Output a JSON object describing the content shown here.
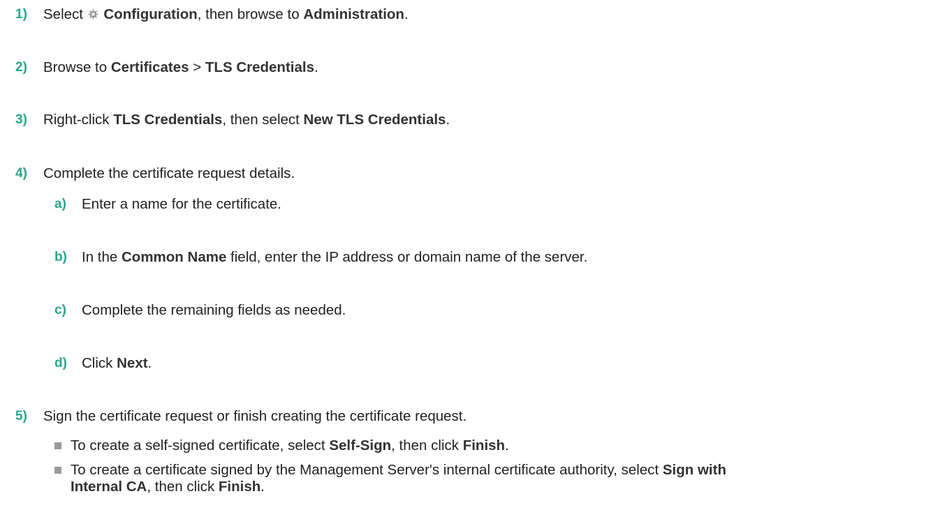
{
  "steps": [
    {
      "num": "1)",
      "t1": "Select ",
      "b1": "Configuration",
      "t2": ", then browse to ",
      "b2": "Administration",
      "t3": "."
    },
    {
      "num": "2)",
      "t1": "Browse to ",
      "b1": "Certificates",
      "t2": " > ",
      "b2": "TLS Credentials",
      "t3": "."
    },
    {
      "num": "3)",
      "t1": "Right-click ",
      "b1": "TLS Credentials",
      "t2": ", then select ",
      "b2": "New TLS Credentials",
      "t3": "."
    },
    {
      "num": "4)",
      "text": "Complete the certificate request details."
    },
    {
      "num": "5)",
      "text": "Sign the certificate request or finish creating the certificate request."
    }
  ],
  "substeps": [
    {
      "num": "a)",
      "text": "Enter a name for the certificate."
    },
    {
      "num": "b)",
      "t1": "In the ",
      "b1": "Common Name",
      "t2": " field, enter the IP address or domain name of the server."
    },
    {
      "num": "c)",
      "text": "Complete the remaining fields as needed."
    },
    {
      "num": "d)",
      "t1": "Click ",
      "b1": "Next",
      "t2": "."
    }
  ],
  "bullets": [
    {
      "t1": "To create a self-signed certificate, select ",
      "b1": "Self-Sign",
      "t2": ", then click ",
      "b2": "Finish",
      "t3": "."
    },
    {
      "t1": "To create a certificate signed by the Management Server's internal certificate authority, select ",
      "b1": "Sign with",
      "b1b": "Internal CA",
      "t2": ", then click ",
      "b2": "Finish",
      "t3": "."
    }
  ],
  "icons": {
    "configuration": "gear-icon",
    "bullet": "square-bullet"
  },
  "colors": {
    "step_number": "#2aa58c",
    "text": "#222222",
    "bullet": "#9a9a9a"
  }
}
